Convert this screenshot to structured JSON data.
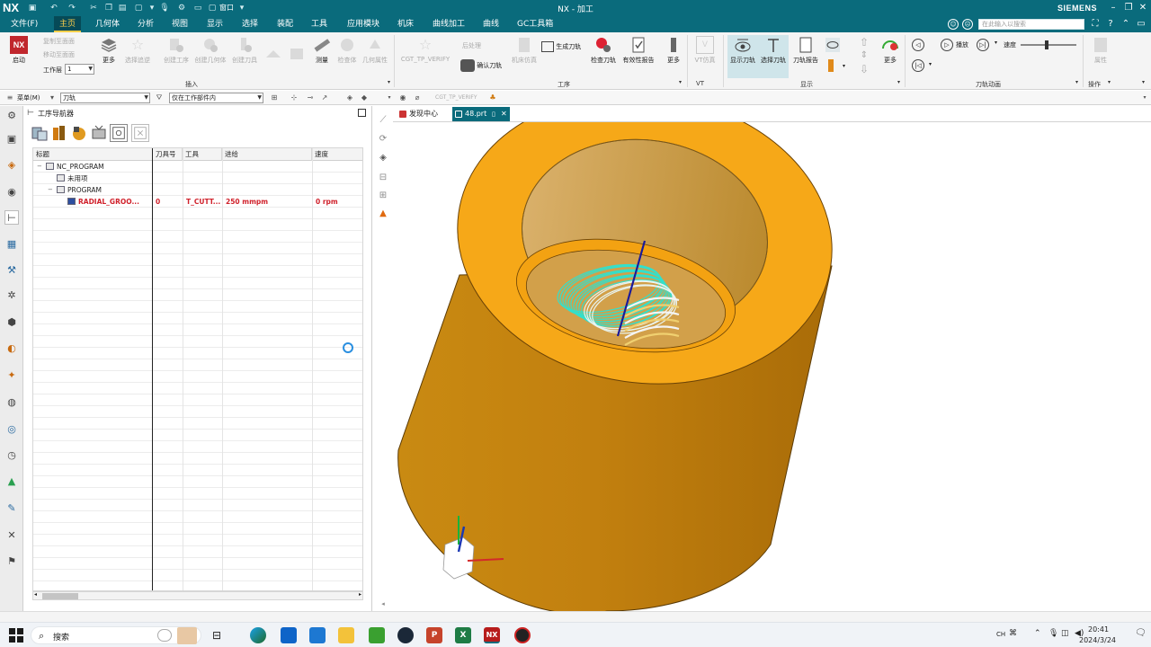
{
  "titlebar": {
    "logo": "NX",
    "title": "NX - 加工",
    "brand": "SIEMENS",
    "window_label": "窗口"
  },
  "menubar": {
    "items": [
      "文件(F)",
      "主页",
      "几何体",
      "分析",
      "视图",
      "显示",
      "选择",
      "装配",
      "工具",
      "应用模块",
      "机床",
      "曲线加工",
      "曲线",
      "GC工具箱"
    ],
    "active_index": 1,
    "search_placeholder": "在此输入以搜索"
  },
  "ribbon": {
    "start": "启动",
    "work_layer": "工作层",
    "work_layer_value": "1",
    "more": "更多",
    "copy_face": "复制至面面",
    "move_face": "移动至面面",
    "select_ops": "选择追逆",
    "create_op": "创建工序",
    "create_geom": "创建几何体",
    "create_tool": "创建刀具",
    "measure": "测量",
    "check_geom": "检查体",
    "geom_props": "几何属性",
    "insert_group": "插入",
    "cgt_verify": "CGT_TP_VERIFY",
    "post": "后处理",
    "generate_toolpath": "生成刀轨",
    "confirm_toolpath": "确认刀轨",
    "machine_sim": "机床仿真",
    "check_toolpath": "检查刀轨",
    "shop_docs": "有效性报告",
    "more2": "更多",
    "vt_sim": "VT仿真",
    "operation_group": "工序",
    "vt_group": "VT",
    "show_toolpath": "显示刀轨",
    "select_toolpath": "选择刀轨",
    "toolpath_report": "刀轨报告",
    "more3": "更多",
    "display_group": "显示",
    "play": "播放",
    "speed": "速度",
    "speed_value": 0.45,
    "animation_group": "刀轨动画",
    "attributes": "属性",
    "operation_group2": "操作"
  },
  "selbar": {
    "menu": "菜单(M)",
    "filter_value": "刀轨",
    "scope_value": "仅在工作部件内",
    "cgt_label": "CGT_TP_VERIFY"
  },
  "navigator": {
    "title": "工序导航器",
    "columns": [
      "标题",
      "刀具号",
      "工具",
      "进给",
      "速度"
    ],
    "rows": [
      {
        "name": "NC_PROGRAM",
        "toolno": "",
        "tool": "",
        "feed": "",
        "speed": "",
        "level": 0,
        "highlight": false
      },
      {
        "name": "未用项",
        "toolno": "",
        "tool": "",
        "feed": "",
        "speed": "",
        "level": 1,
        "highlight": false
      },
      {
        "name": "PROGRAM",
        "toolno": "",
        "tool": "",
        "feed": "",
        "speed": "",
        "level": 1,
        "highlight": false
      },
      {
        "name": "RADIAL_GROO...",
        "toolno": "0",
        "tool": "T_CUTT...",
        "feed": "250 mmpm",
        "speed": "0 rpm",
        "level": 2,
        "highlight": true
      }
    ]
  },
  "tabs": [
    {
      "label": "发现中心",
      "active": false
    },
    {
      "label": "48.prt",
      "active": true
    }
  ],
  "colors": {
    "accent": "#0a6b7c",
    "part_face": "#f5a818",
    "part_body": "#c98412",
    "toolpath": "#32e0cc"
  },
  "taskbar": {
    "search": "搜索",
    "time": "20:41",
    "date": "2024/3/24",
    "lang": "CH"
  }
}
